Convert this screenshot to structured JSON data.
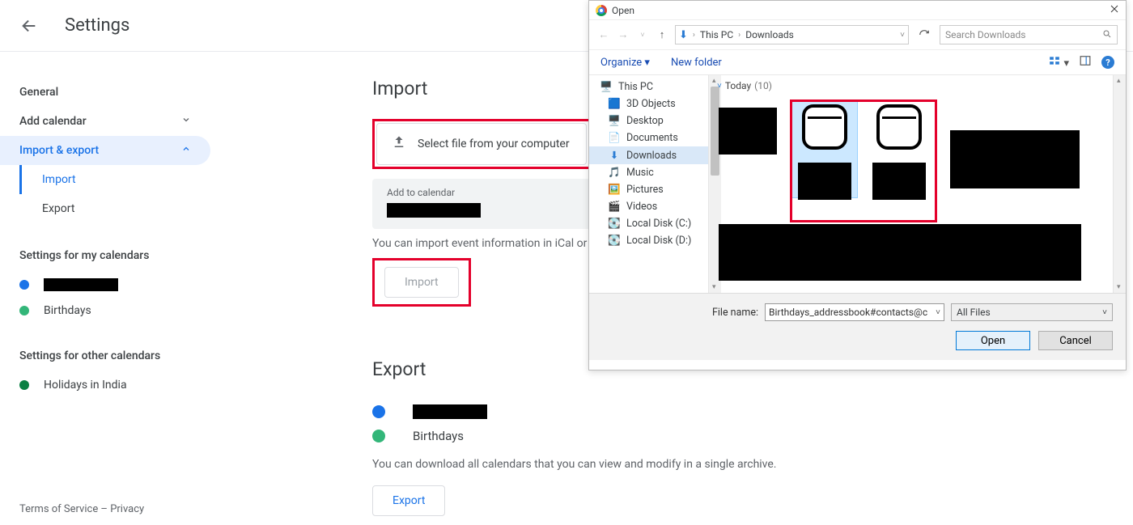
{
  "header": {
    "title": "Settings"
  },
  "nav": {
    "general": "General",
    "addCalendar": "Add calendar",
    "importExport": "Import & export",
    "importItem": "Import",
    "exportItem": "Export",
    "myCalendars": "Settings for my calendars",
    "birthdays": "Birthdays",
    "otherCalendars": "Settings for other calendars",
    "holidays": "Holidays in India"
  },
  "footer": {
    "text": "Terms of Service – Privacy"
  },
  "importSection": {
    "title": "Import",
    "selectFile": "Select file from your computer",
    "addToCalendar": "Add to calendar",
    "helpText": "You can import event information in iCal or VCS",
    "importBtn": "Import"
  },
  "exportSection": {
    "title": "Export",
    "birthdays": "Birthdays",
    "helpText": "You can download all calendars that you can view and modify in a single archive.",
    "exportBtn": "Export"
  },
  "dialog": {
    "title": "Open",
    "path1": "This PC",
    "path2": "Downloads",
    "searchPh": "Search Downloads",
    "organize": "Organize",
    "newFolder": "New folder",
    "tree": {
      "thisPC": "This PC",
      "objects3d": "3D Objects",
      "desktop": "Desktop",
      "documents": "Documents",
      "downloads": "Downloads",
      "music": "Music",
      "pictures": "Pictures",
      "videos": "Videos",
      "diskC": "Local Disk (C:)",
      "diskD": "Local Disk (D:)"
    },
    "filesHeader": "Today",
    "filesCount": "(10)",
    "fileNameLabel": "File name:",
    "fileNameValue": "Birthdays_addressbook#contacts@c",
    "fileType": "All Files",
    "openBtn": "Open",
    "cancelBtn": "Cancel"
  }
}
